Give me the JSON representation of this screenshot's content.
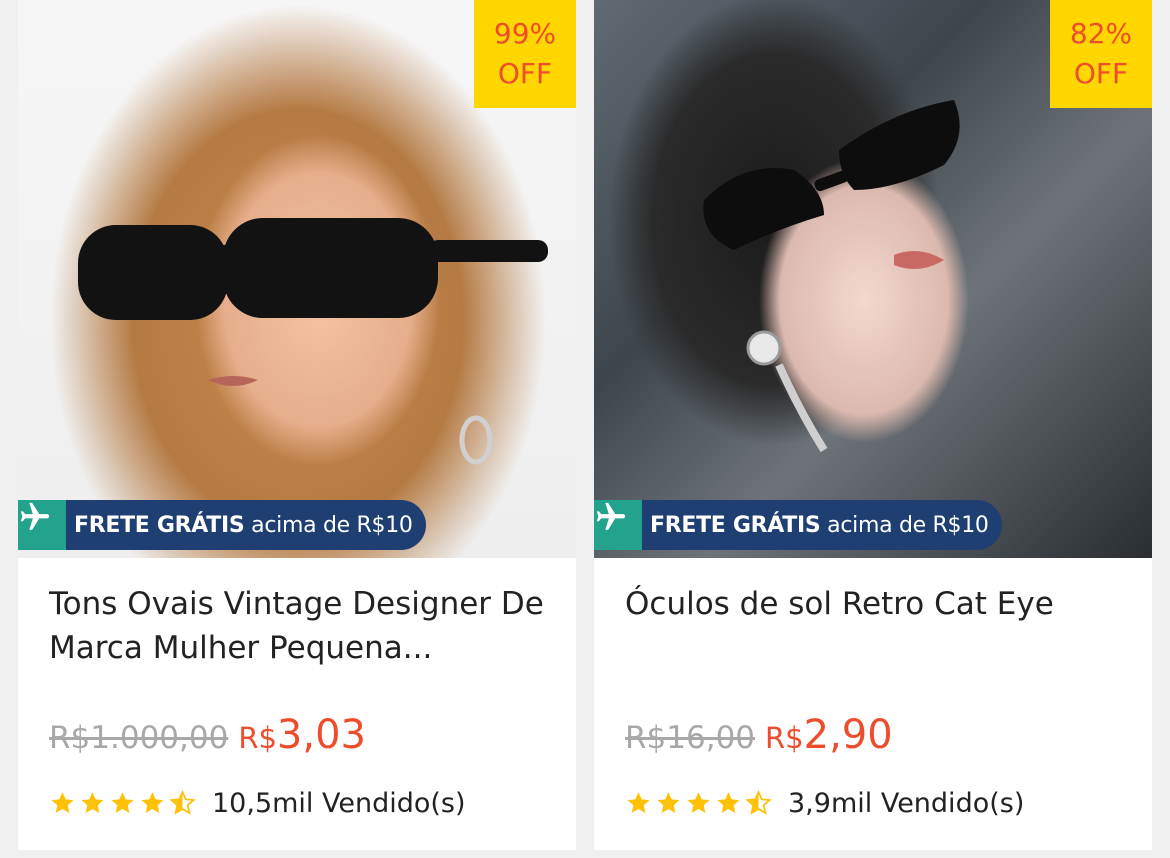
{
  "products": [
    {
      "image": "woman wearing black rectangular sunglasses",
      "discount_pct": "99%",
      "discount_off": "OFF",
      "shipping_strong": "FRETE GRÁTIS",
      "shipping_rest": "acima de R$10",
      "title": "Tons Ovais Vintage Designer De Marca Mulher Pequena...",
      "old_price": "R$1.000,00",
      "currency": "R$",
      "price": "3,03",
      "rating": 4.5,
      "sold": "10,5mil Vendido(s)"
    },
    {
      "image": "woman wearing black cat eye sunglasses",
      "discount_pct": "82%",
      "discount_off": "OFF",
      "shipping_strong": "FRETE GRÁTIS",
      "shipping_rest": "acima de R$10",
      "title": "Óculos de sol Retro Cat Eye",
      "old_price": "R$16,00",
      "currency": "R$",
      "price": "2,90",
      "rating": 4.5,
      "sold": "3,9mil Vendido(s)"
    }
  ],
  "colors": {
    "accent": "#ee4d2d",
    "badge": "#ffd600",
    "shipping_bg": "#1f3f73",
    "shipping_icon_bg": "#23a38d",
    "star": "#ffc107"
  },
  "icons": {
    "shipping": "airplane-icon",
    "rating": "star-icon"
  }
}
